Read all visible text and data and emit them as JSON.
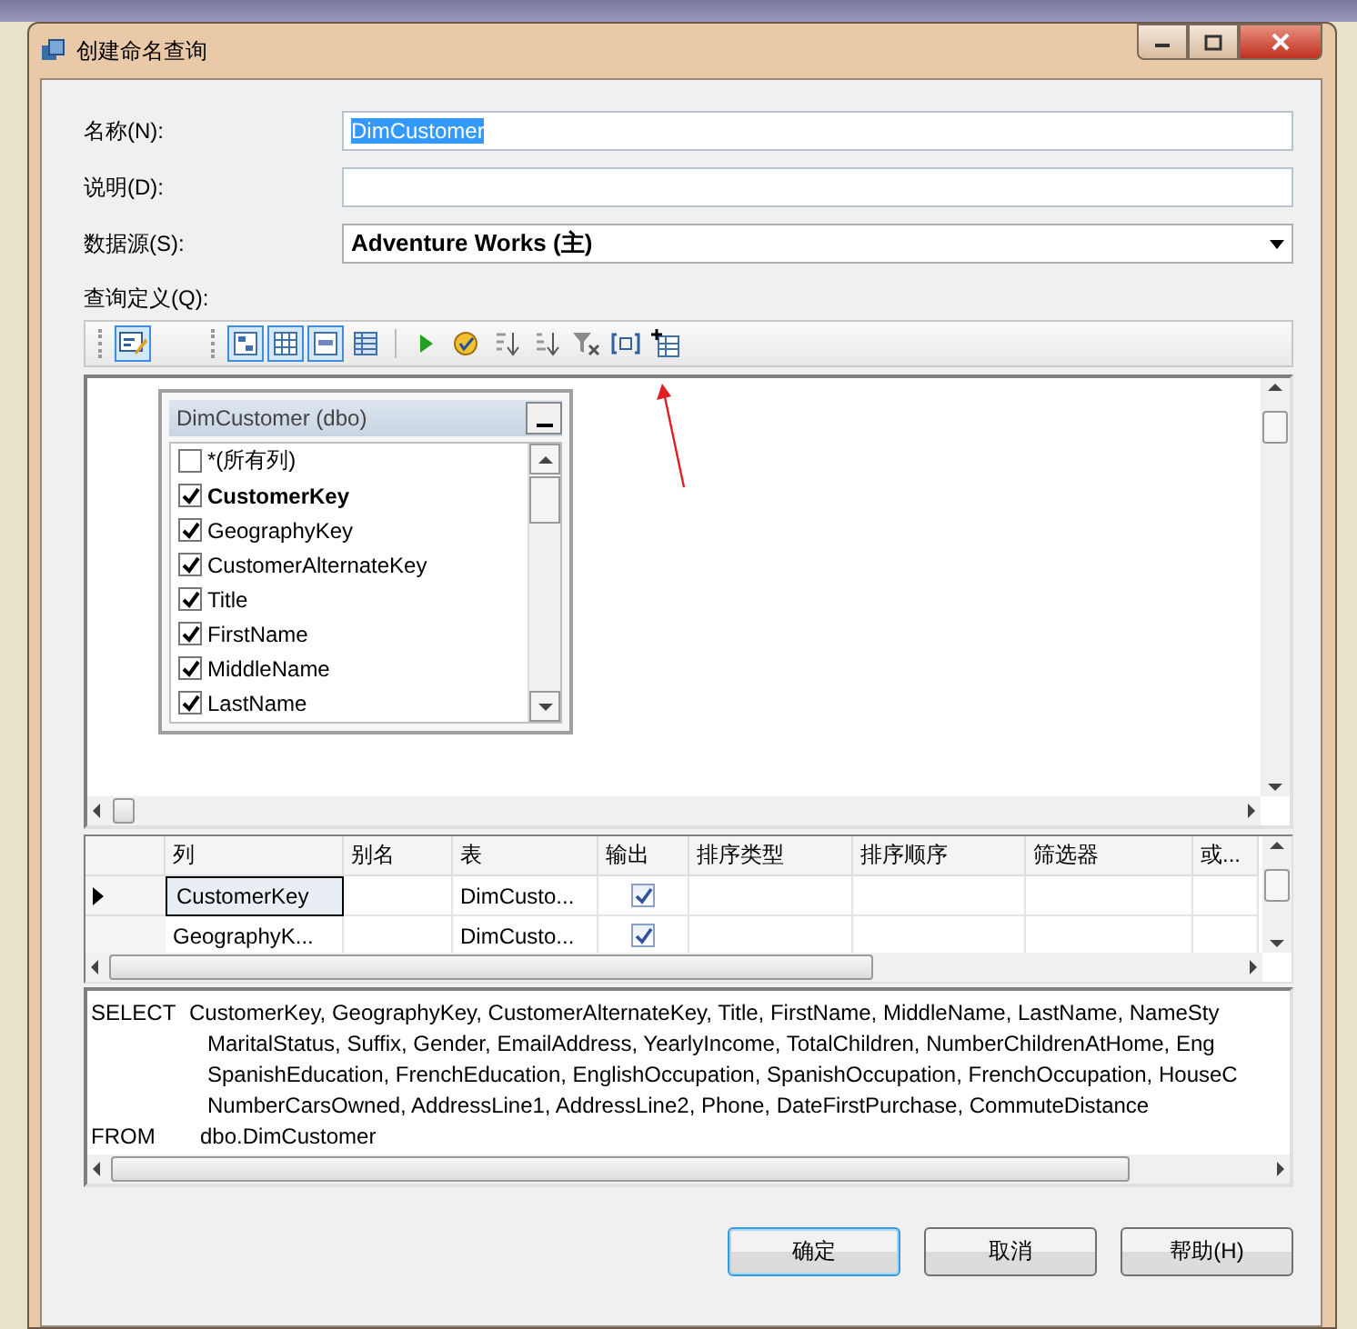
{
  "window": {
    "title": "创建命名查询"
  },
  "form": [
    {
      "label": "名称(N):",
      "kind": "text",
      "value": "DimCustomer",
      "value_selected": true
    },
    {
      "label": "说明(D):",
      "kind": "text"
    },
    {
      "label": "数据源(S):",
      "kind": "dropdown",
      "value": "Adventure Works (主)"
    }
  ],
  "query_label": "查询定义(Q):",
  "toolbar": [
    [
      {
        "kind": "properties",
        "selected": true
      }
    ],
    [
      {
        "kind": "diagram",
        "selected": true
      },
      {
        "kind": "grid",
        "selected": true
      },
      {
        "kind": "sql",
        "selected": true
      },
      {
        "kind": "results",
        "selected": false
      }
    ],
    [
      {
        "kind": "run",
        "selected": false
      },
      {
        "kind": "verify",
        "selected": false
      },
      {
        "kind": "sort-asc",
        "selected": false
      },
      {
        "kind": "sort-desc",
        "selected": false
      },
      {
        "kind": "filter",
        "selected": false
      },
      {
        "kind": "group",
        "selected": false
      },
      {
        "kind": "add-table",
        "selected": false
      }
    ]
  ],
  "annotation_arrow": true,
  "diagram": {
    "table": {
      "title": "DimCustomer (dbo)",
      "columns": [
        {
          "label": "*(所有列)",
          "checked": false,
          "primary_key": false
        },
        {
          "label": "CustomerKey",
          "checked": true,
          "primary_key": true
        },
        {
          "label": "GeographyKey",
          "checked": true,
          "primary_key": false
        },
        {
          "label": "CustomerAlternateKey",
          "checked": true,
          "primary_key": false
        },
        {
          "label": "Title",
          "checked": true,
          "primary_key": false
        },
        {
          "label": "FirstName",
          "checked": true,
          "primary_key": false
        },
        {
          "label": "MiddleName",
          "checked": true,
          "primary_key": false
        },
        {
          "label": "LastName",
          "checked": true,
          "primary_key": false
        }
      ]
    }
  },
  "grid": {
    "columns": [
      "列",
      "别名",
      "表",
      "输出",
      "排序类型",
      "排序顺序",
      "筛选器",
      "或..."
    ],
    "rows": [
      {
        "selected": true,
        "column": "CustomerKey",
        "table": "DimCusto...",
        "output": true
      },
      {
        "selected": false,
        "column": "GeographyK...",
        "table": "DimCusto...",
        "output": true
      }
    ]
  },
  "sql": {
    "lines": [
      {
        "keyword": "SELECT",
        "text": "CustomerKey, GeographyKey, CustomerAlternateKey, Title, FirstName, MiddleName, LastName, NameSty"
      },
      {
        "text": "MaritalStatus, Suffix, Gender, EmailAddress, YearlyIncome, TotalChildren, NumberChildrenAtHome, Eng"
      },
      {
        "text": "SpanishEducation, FrenchEducation, EnglishOccupation, SpanishOccupation, FrenchOccupation, HouseC"
      },
      {
        "text": "NumberCarsOwned, AddressLine1, AddressLine2, Phone, DateFirstPurchase, CommuteDistance"
      },
      {
        "keyword": "FROM",
        "text": "dbo.DimCustomer"
      }
    ]
  },
  "buttons": [
    {
      "label": "确定",
      "default": true
    },
    {
      "label": "取消",
      "default": false
    },
    {
      "label": "帮助(H)",
      "default": false
    }
  ]
}
